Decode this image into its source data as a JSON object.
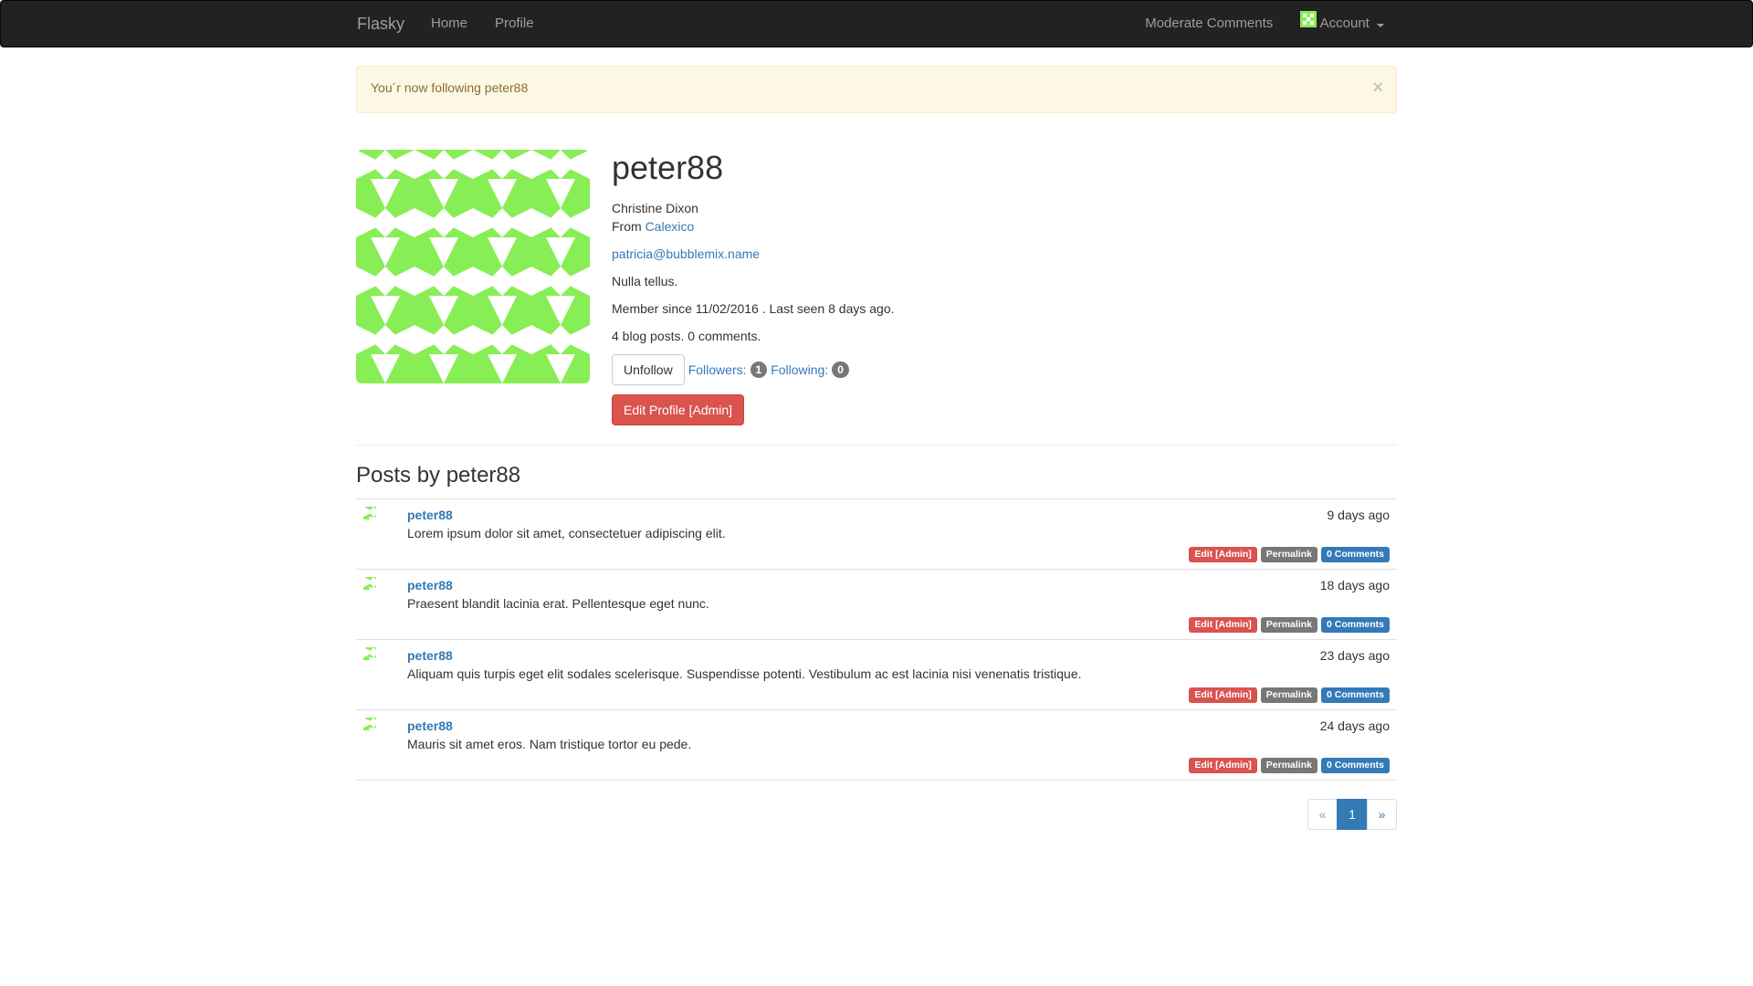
{
  "colors": {
    "navbar": "#222222",
    "avatar_green": "#88ee55",
    "link": "#337ab7",
    "danger": "#d9534f",
    "default_label": "#777777",
    "alert_bg": "#fcf8e3"
  },
  "navbar": {
    "brand": "Flasky",
    "home": "Home",
    "profile": "Profile",
    "moderate": "Moderate Comments",
    "account": "Account"
  },
  "alert": {
    "message": "You´r now following peter88",
    "close": "×"
  },
  "profile": {
    "username": "peter88",
    "name": "Christine Dixon",
    "from_prefix": "From ",
    "location": "Calexico",
    "email": "patricia@bubblemix.name",
    "about": "Nulla tellus.",
    "member_since": "Member since 11/02/2016 . Last seen 8 days ago.",
    "stats": "4 blog posts. 0 comments.",
    "unfollow_button": "Unfollow",
    "followers_label": "Followers:",
    "followers_count": "1",
    "following_label": "Following:",
    "following_count": "0",
    "edit_button": "Edit Profile [Admin]"
  },
  "posts_heading": "Posts by peter88",
  "posts": [
    {
      "author": "peter88",
      "body": "Lorem ipsum dolor sit amet, consectetuer adipiscing elit.",
      "date": "9 days ago",
      "edit": "Edit [Admin]",
      "permalink": "Permalink",
      "comments": "0 Comments"
    },
    {
      "author": "peter88",
      "body": "Praesent blandit lacinia erat. Pellentesque eget nunc.",
      "date": "18 days ago",
      "edit": "Edit [Admin]",
      "permalink": "Permalink",
      "comments": "0 Comments"
    },
    {
      "author": "peter88",
      "body": "Aliquam quis turpis eget elit sodales scelerisque. Suspendisse potenti. Vestibulum ac est lacinia nisi venenatis tristique.",
      "date": "23 days ago",
      "edit": "Edit [Admin]",
      "permalink": "Permalink",
      "comments": "0 Comments"
    },
    {
      "author": "peter88",
      "body": "Mauris sit amet eros. Nam tristique tortor eu pede.",
      "date": "24 days ago",
      "edit": "Edit [Admin]",
      "permalink": "Permalink",
      "comments": "0 Comments"
    }
  ],
  "pagination": {
    "prev": "«",
    "current": "1",
    "next": "»"
  }
}
